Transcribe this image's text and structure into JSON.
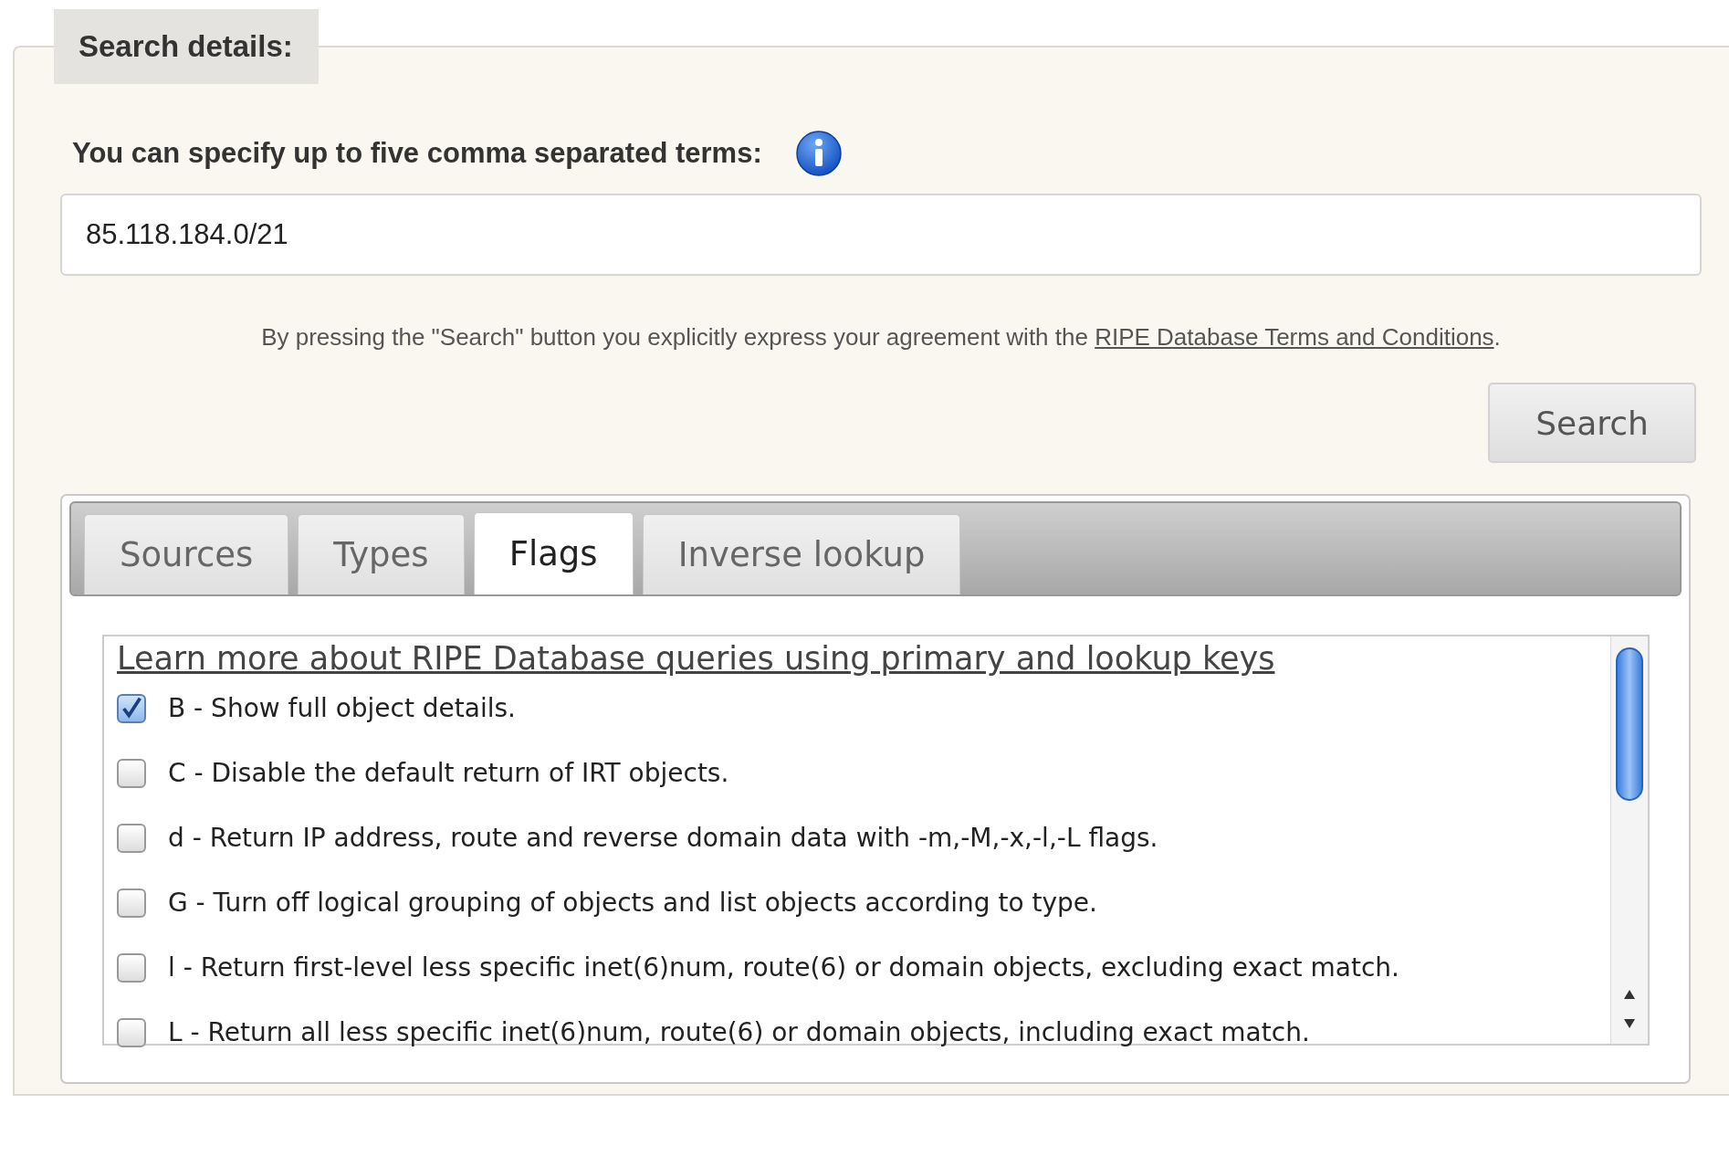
{
  "section": {
    "legend": "Search details:"
  },
  "query": {
    "label": "You can specify up to five comma separated terms:",
    "value": "85.118.184.0/21"
  },
  "agreement": {
    "text": "By pressing the \"Search\" button you explicitly express your agreement with the ",
    "link": "RIPE Database Terms and Conditions",
    "end": "."
  },
  "search_button": "Search",
  "tabs": [
    {
      "label": "Sources",
      "selected": false
    },
    {
      "label": "Types",
      "selected": false
    },
    {
      "label": "Flags",
      "selected": true
    },
    {
      "label": "Inverse lookup",
      "selected": false
    }
  ],
  "flags": {
    "link": "Learn more about RIPE Database queries using primary and lookup keys",
    "items": [
      {
        "label": "B - Show full object details.",
        "checked": true
      },
      {
        "label": "C - Disable the default return of IRT objects.",
        "checked": false
      },
      {
        "label": "d - Return IP address, route and reverse domain data with -m,-M,-x,-l,-L flags.",
        "checked": false
      },
      {
        "label": "G - Turn off logical grouping of objects and list objects according to type.",
        "checked": false
      },
      {
        "label": "l - Return first-level less specific inet(6)num, route(6) or domain objects, excluding exact match.",
        "checked": false
      },
      {
        "label": "L - Return all less specific inet(6)num, route(6) or domain objects, including exact match.",
        "checked": false
      }
    ]
  }
}
